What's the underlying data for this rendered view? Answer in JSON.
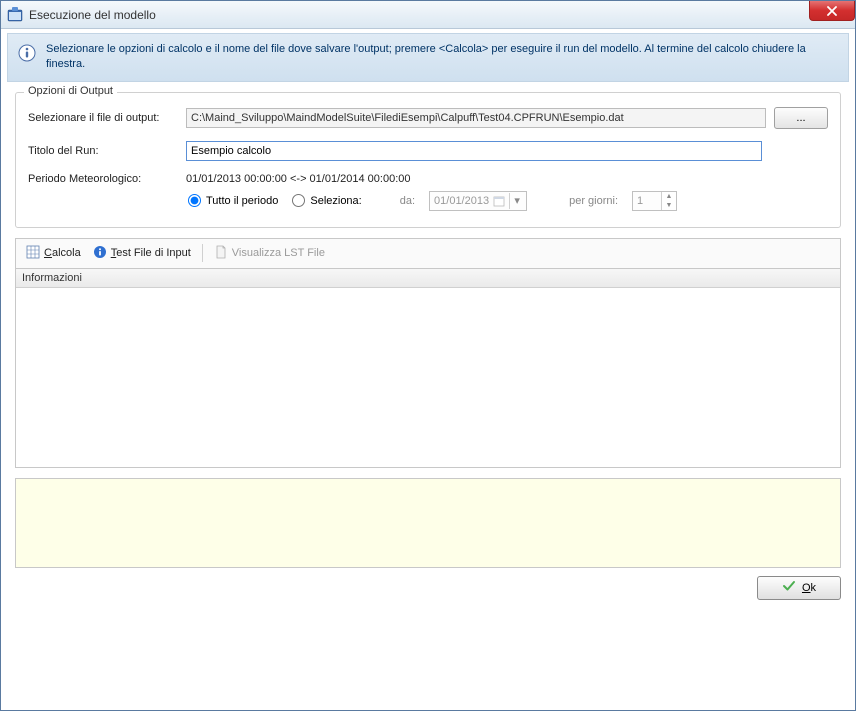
{
  "window": {
    "title": "Esecuzione del modello"
  },
  "banner": {
    "text": "Selezionare le opzioni di calcolo e il nome del file dove salvare l'output; premere <Calcola> per eseguire il run del modello. Al termine del calcolo chiudere la finestra."
  },
  "options": {
    "legend": "Opzioni di Output",
    "output_file_label": "Selezionare il file di output:",
    "output_file_value": "C:\\Maind_Sviluppo\\MaindModelSuite\\FilediEsempi\\Calpuff\\Test04.CPFRUN\\Esempio.dat",
    "browse_label": "...",
    "title_label": "Titolo del Run:",
    "title_value": "Esempio calcolo",
    "period_label": "Periodo Meteorologico:",
    "period_value": "01/01/2013 00:00:00 <-> 01/01/2014 00:00:00",
    "radio_all": "Tutto il periodo",
    "radio_select": "Seleziona:",
    "from_label": "da:",
    "date_value": "01/01/2013",
    "days_label": "per giorni:",
    "days_value": "1"
  },
  "toolbar": {
    "calcola": "Calcola",
    "test": "Test File di Input",
    "visualizza": "Visualizza LST File"
  },
  "list": {
    "header": "Informazioni"
  },
  "footer": {
    "ok": "Ok"
  }
}
